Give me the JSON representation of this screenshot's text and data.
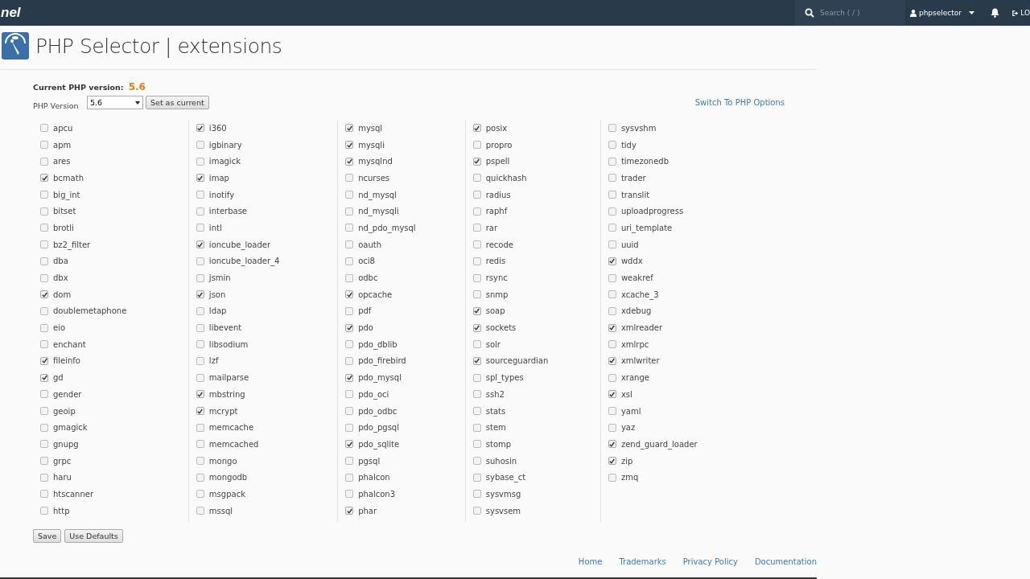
{
  "topbar": {
    "logo": "nel",
    "search": {
      "placeholder": "Search ( / )"
    },
    "user": "phpselector",
    "logout": "LO"
  },
  "page": {
    "title": "PHP Selector | extensions"
  },
  "current_version": {
    "label": "Current PHP version:",
    "value": "5.6"
  },
  "version_select": {
    "label": "PHP Version",
    "value": "5.6",
    "button": "Set as current"
  },
  "switch_link": "Switch To PHP Options",
  "columns": [
    [
      {
        "label": "apcu",
        "checked": false
      },
      {
        "label": "apm",
        "checked": false
      },
      {
        "label": "ares",
        "checked": false
      },
      {
        "label": "bcmath",
        "checked": true
      },
      {
        "label": "big_int",
        "checked": false
      },
      {
        "label": "bitset",
        "checked": false
      },
      {
        "label": "brotli",
        "checked": false
      },
      {
        "label": "bz2_filter",
        "checked": false
      },
      {
        "label": "dba",
        "checked": false
      },
      {
        "label": "dbx",
        "checked": false
      },
      {
        "label": "dom",
        "checked": true
      },
      {
        "label": "doublemetaphone",
        "checked": false
      },
      {
        "label": "eio",
        "checked": false
      },
      {
        "label": "enchant",
        "checked": false
      },
      {
        "label": "fileinfo",
        "checked": true
      },
      {
        "label": "gd",
        "checked": true
      },
      {
        "label": "gender",
        "checked": false
      },
      {
        "label": "geoip",
        "checked": false
      },
      {
        "label": "gmagick",
        "checked": false
      },
      {
        "label": "gnupg",
        "checked": false
      },
      {
        "label": "grpc",
        "checked": false
      },
      {
        "label": "haru",
        "checked": false
      },
      {
        "label": "htscanner",
        "checked": false
      },
      {
        "label": "http",
        "checked": false
      }
    ],
    [
      {
        "label": "i360",
        "checked": true
      },
      {
        "label": "igbinary",
        "checked": false
      },
      {
        "label": "imagick",
        "checked": false
      },
      {
        "label": "imap",
        "checked": true
      },
      {
        "label": "inotify",
        "checked": false
      },
      {
        "label": "interbase",
        "checked": false
      },
      {
        "label": "intl",
        "checked": false
      },
      {
        "label": "ioncube_loader",
        "checked": true
      },
      {
        "label": "ioncube_loader_4",
        "checked": false
      },
      {
        "label": "jsmin",
        "checked": false
      },
      {
        "label": "json",
        "checked": true
      },
      {
        "label": "ldap",
        "checked": false
      },
      {
        "label": "libevent",
        "checked": false
      },
      {
        "label": "libsodium",
        "checked": false
      },
      {
        "label": "lzf",
        "checked": false
      },
      {
        "label": "mailparse",
        "checked": false
      },
      {
        "label": "mbstring",
        "checked": true
      },
      {
        "label": "mcrypt",
        "checked": true
      },
      {
        "label": "memcache",
        "checked": false
      },
      {
        "label": "memcached",
        "checked": false
      },
      {
        "label": "mongo",
        "checked": false
      },
      {
        "label": "mongodb",
        "checked": false
      },
      {
        "label": "msgpack",
        "checked": false
      },
      {
        "label": "mssql",
        "checked": false
      }
    ],
    [
      {
        "label": "mysql",
        "checked": true
      },
      {
        "label": "mysqli",
        "checked": true
      },
      {
        "label": "mysqlnd",
        "checked": true
      },
      {
        "label": "ncurses",
        "checked": false
      },
      {
        "label": "nd_mysql",
        "checked": false
      },
      {
        "label": "nd_mysqli",
        "checked": false
      },
      {
        "label": "nd_pdo_mysql",
        "checked": false
      },
      {
        "label": "oauth",
        "checked": false
      },
      {
        "label": "oci8",
        "checked": false
      },
      {
        "label": "odbc",
        "checked": false
      },
      {
        "label": "opcache",
        "checked": true
      },
      {
        "label": "pdf",
        "checked": false
      },
      {
        "label": "pdo",
        "checked": true
      },
      {
        "label": "pdo_dblib",
        "checked": false
      },
      {
        "label": "pdo_firebird",
        "checked": false
      },
      {
        "label": "pdo_mysql",
        "checked": true
      },
      {
        "label": "pdo_oci",
        "checked": false
      },
      {
        "label": "pdo_odbc",
        "checked": false
      },
      {
        "label": "pdo_pgsql",
        "checked": false
      },
      {
        "label": "pdo_sqlite",
        "checked": true
      },
      {
        "label": "pgsql",
        "checked": false
      },
      {
        "label": "phalcon",
        "checked": false
      },
      {
        "label": "phalcon3",
        "checked": false
      },
      {
        "label": "phar",
        "checked": true
      }
    ],
    [
      {
        "label": "posix",
        "checked": true
      },
      {
        "label": "propro",
        "checked": false
      },
      {
        "label": "pspell",
        "checked": true
      },
      {
        "label": "quickhash",
        "checked": false
      },
      {
        "label": "radius",
        "checked": false
      },
      {
        "label": "raphf",
        "checked": false
      },
      {
        "label": "rar",
        "checked": false
      },
      {
        "label": "recode",
        "checked": false
      },
      {
        "label": "redis",
        "checked": false
      },
      {
        "label": "rsync",
        "checked": false
      },
      {
        "label": "snmp",
        "checked": false
      },
      {
        "label": "soap",
        "checked": true
      },
      {
        "label": "sockets",
        "checked": true
      },
      {
        "label": "solr",
        "checked": false
      },
      {
        "label": "sourceguardian",
        "checked": true
      },
      {
        "label": "spl_types",
        "checked": false
      },
      {
        "label": "ssh2",
        "checked": false
      },
      {
        "label": "stats",
        "checked": false
      },
      {
        "label": "stem",
        "checked": false
      },
      {
        "label": "stomp",
        "checked": false
      },
      {
        "label": "suhosin",
        "checked": false
      },
      {
        "label": "sybase_ct",
        "checked": false
      },
      {
        "label": "sysvmsg",
        "checked": false
      },
      {
        "label": "sysvsem",
        "checked": false
      }
    ],
    [
      {
        "label": "sysvshm",
        "checked": false
      },
      {
        "label": "tidy",
        "checked": false
      },
      {
        "label": "timezonedb",
        "checked": false
      },
      {
        "label": "trader",
        "checked": false
      },
      {
        "label": "translit",
        "checked": false
      },
      {
        "label": "uploadprogress",
        "checked": false
      },
      {
        "label": "uri_template",
        "checked": false
      },
      {
        "label": "uuid",
        "checked": false
      },
      {
        "label": "wddx",
        "checked": true
      },
      {
        "label": "weakref",
        "checked": false
      },
      {
        "label": "xcache_3",
        "checked": false
      },
      {
        "label": "xdebug",
        "checked": false
      },
      {
        "label": "xmlreader",
        "checked": true
      },
      {
        "label": "xmlrpc",
        "checked": false
      },
      {
        "label": "xmlwriter",
        "checked": true
      },
      {
        "label": "xrange",
        "checked": false
      },
      {
        "label": "xsl",
        "checked": true
      },
      {
        "label": "yaml",
        "checked": false
      },
      {
        "label": "yaz",
        "checked": false
      },
      {
        "label": "zend_guard_loader",
        "checked": true
      },
      {
        "label": "zip",
        "checked": true
      },
      {
        "label": "zmq",
        "checked": false
      }
    ]
  ],
  "buttons": [
    "Save",
    "Use Defaults"
  ],
  "footer": [
    "Home",
    "Trademarks",
    "Privacy Policy",
    "Documentation"
  ]
}
